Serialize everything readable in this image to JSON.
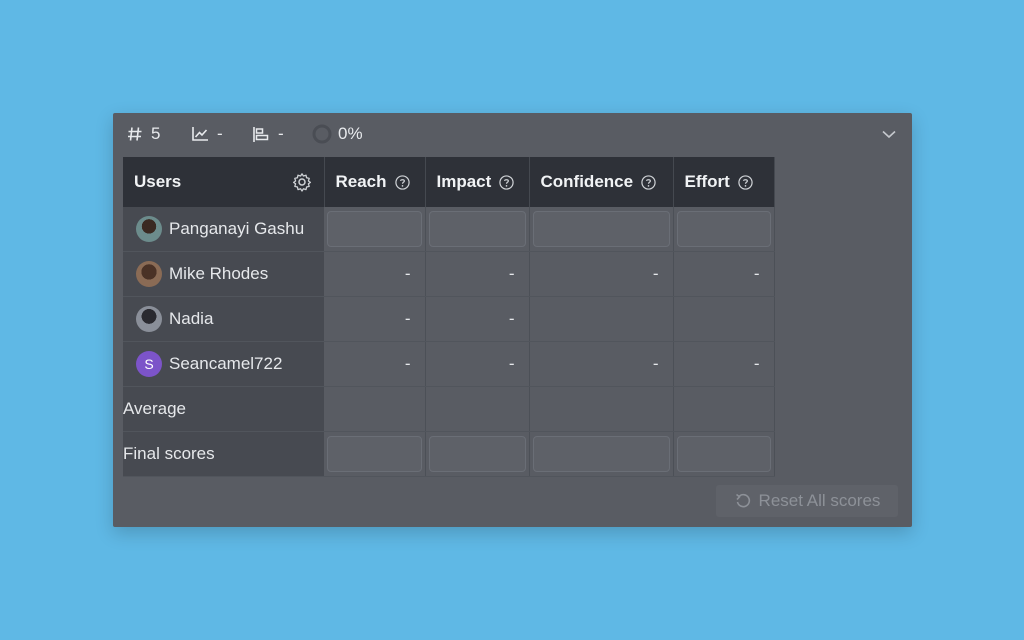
{
  "toolbar": {
    "number_value": "5",
    "chart_value": "-",
    "align_value": "-",
    "progress_percent": "0%",
    "progress_fraction": 0
  },
  "table": {
    "columns": [
      "Users",
      "Reach",
      "Impact",
      "Confidence",
      "Effort"
    ],
    "rows": [
      {
        "name": "Panganayi Gashu",
        "avatar": "photo",
        "mode": "input",
        "cells": [
          "",
          "",
          "",
          ""
        ]
      },
      {
        "name": "Mike Rhodes",
        "avatar": "photo",
        "mode": "text",
        "cells": [
          "-",
          "-",
          "-",
          "-"
        ]
      },
      {
        "name": "Nadia",
        "avatar": "photo",
        "mode": "text",
        "cells": [
          "-",
          "-",
          "",
          ""
        ]
      },
      {
        "name": "Seancamel722",
        "avatar": "S",
        "mode": "text",
        "cells": [
          "-",
          "-",
          "-",
          "-"
        ]
      }
    ],
    "average_label": "Average",
    "final_label": "Final scores"
  },
  "reset_label": "Reset All scores",
  "colors": {
    "background": "#5fb8e5",
    "panel": "#595c63",
    "header": "#2e3138",
    "avatar_s": "#7c54c9"
  }
}
